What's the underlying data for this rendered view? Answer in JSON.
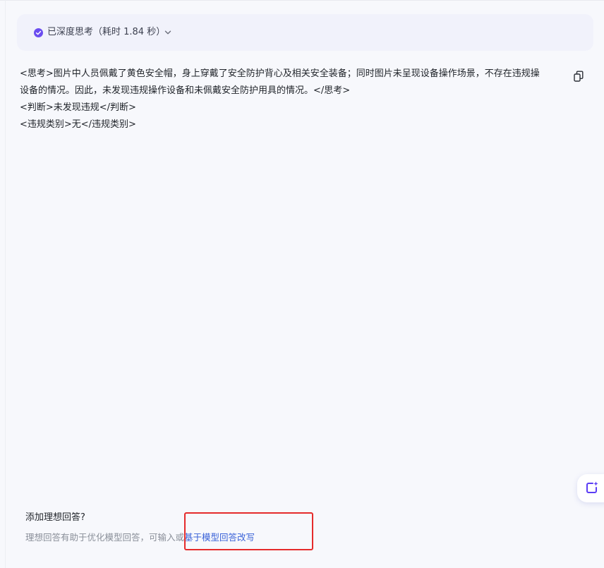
{
  "thinking": {
    "label": "已深度思考（耗时 1.84 秒）",
    "accent_color": "#6b4df0"
  },
  "answer": {
    "lines": [
      "<思考>图片中人员佩戴了黄色安全帽，身上穿戴了安全防护背心及相关安全装备；同时图片未呈现设备操作场景，不存在违规操",
      "设备的情况。因此，未发现违规操作设备和未佩戴安全防护用具的情况。</思考>",
      "<判断>未发现违规</判断>",
      "<违规类别>无</违规类别>"
    ],
    "copy_icon": "copy-icon"
  },
  "ideal_answer": {
    "title": "添加理想回答?",
    "description": "理想回答有助于优化模型回答，可输入或",
    "link": "基于模型回答改写"
  },
  "float_button": {
    "icon": "ai-edit-icon"
  },
  "highlight": {
    "color": "#e52b2b"
  }
}
